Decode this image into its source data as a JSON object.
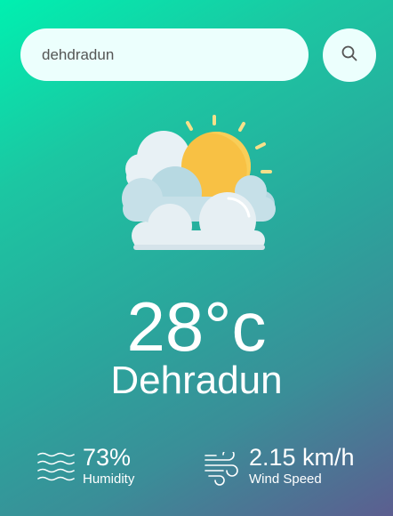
{
  "search": {
    "value": "dehdradun",
    "placeholder": "",
    "button_icon": "search-icon"
  },
  "weather": {
    "icon": "sun-behind-clouds-icon",
    "temperature": "28°c",
    "city": "Dehradun"
  },
  "details": {
    "humidity": {
      "icon": "humidity-waves-icon",
      "value": "73%",
      "label": "Humidity"
    },
    "wind": {
      "icon": "wind-icon",
      "value": "2.15 km/h",
      "label": "Wind Speed"
    }
  },
  "colors": {
    "gradient_start": "#00f0b0",
    "gradient_mid": "#2aa69c",
    "gradient_end": "#5c5e90",
    "search_bg": "#ecfffd",
    "text": "#ffffff",
    "sun": "#f8c144",
    "cloud": "#e6eff3"
  }
}
